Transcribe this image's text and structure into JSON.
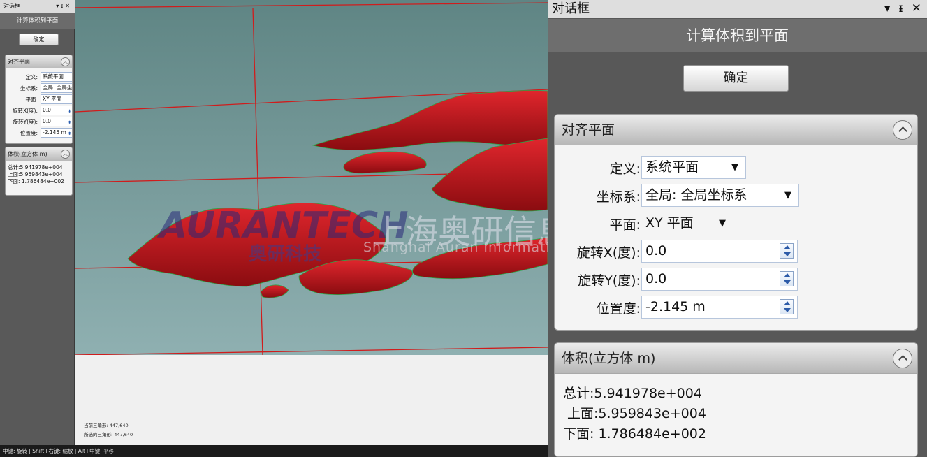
{
  "dialog": {
    "title": "对话框",
    "ctrl_dropdown": "▾",
    "ctrl_pin": "ᵻ",
    "ctrl_close": "✕",
    "header": "计算体积到平面",
    "ok_label": "确定"
  },
  "align_group": {
    "title": "对齐平面",
    "rows": [
      {
        "label": "定义:",
        "value": "系统平面",
        "control": "dropdown"
      },
      {
        "label": "坐标系:",
        "value": "全局: 全局坐标系",
        "control": "dropdown"
      },
      {
        "label": "平面:",
        "value": "XY 平面",
        "control": "dropdown"
      },
      {
        "label": "旋转X(度):",
        "value": "0.0",
        "control": "spinner"
      },
      {
        "label": "旋转Y(度):",
        "value": "0.0",
        "control": "spinner"
      },
      {
        "label": "位置度:",
        "value": "-2.145 m",
        "control": "spinner"
      }
    ]
  },
  "small_dialog": {
    "coord_value_short": "全局: 全局坐",
    "plane_value_short": "XY 平面",
    "pos_value_short": "-2.145 m"
  },
  "volume_group": {
    "title": "体积(立方体 m)",
    "total": "总计:5.941978e+004",
    "upper": "上面:5.959843e+004",
    "lower": "下面: 1.786484e+002"
  },
  "viewport": {
    "current_triangles": "当前三角形: 447,640",
    "selected_triangles": "所选的三角形: 447,640",
    "watermark_en": "AURANTECH",
    "watermark_cn_logo": "奥研科技",
    "watermark_cn": "上海奥研信息科技有限公司",
    "watermark_sub": "Shanghai Auran Information Technology Co.,Ltd",
    "colors": {
      "background_top": "#5f8584",
      "mesh": "#c4141a",
      "grid_line": "#d01c1c"
    }
  },
  "statusbar": {
    "text": "中键: 旋转 | Shift+右键: 缩放 | Alt+中键: 平移"
  }
}
